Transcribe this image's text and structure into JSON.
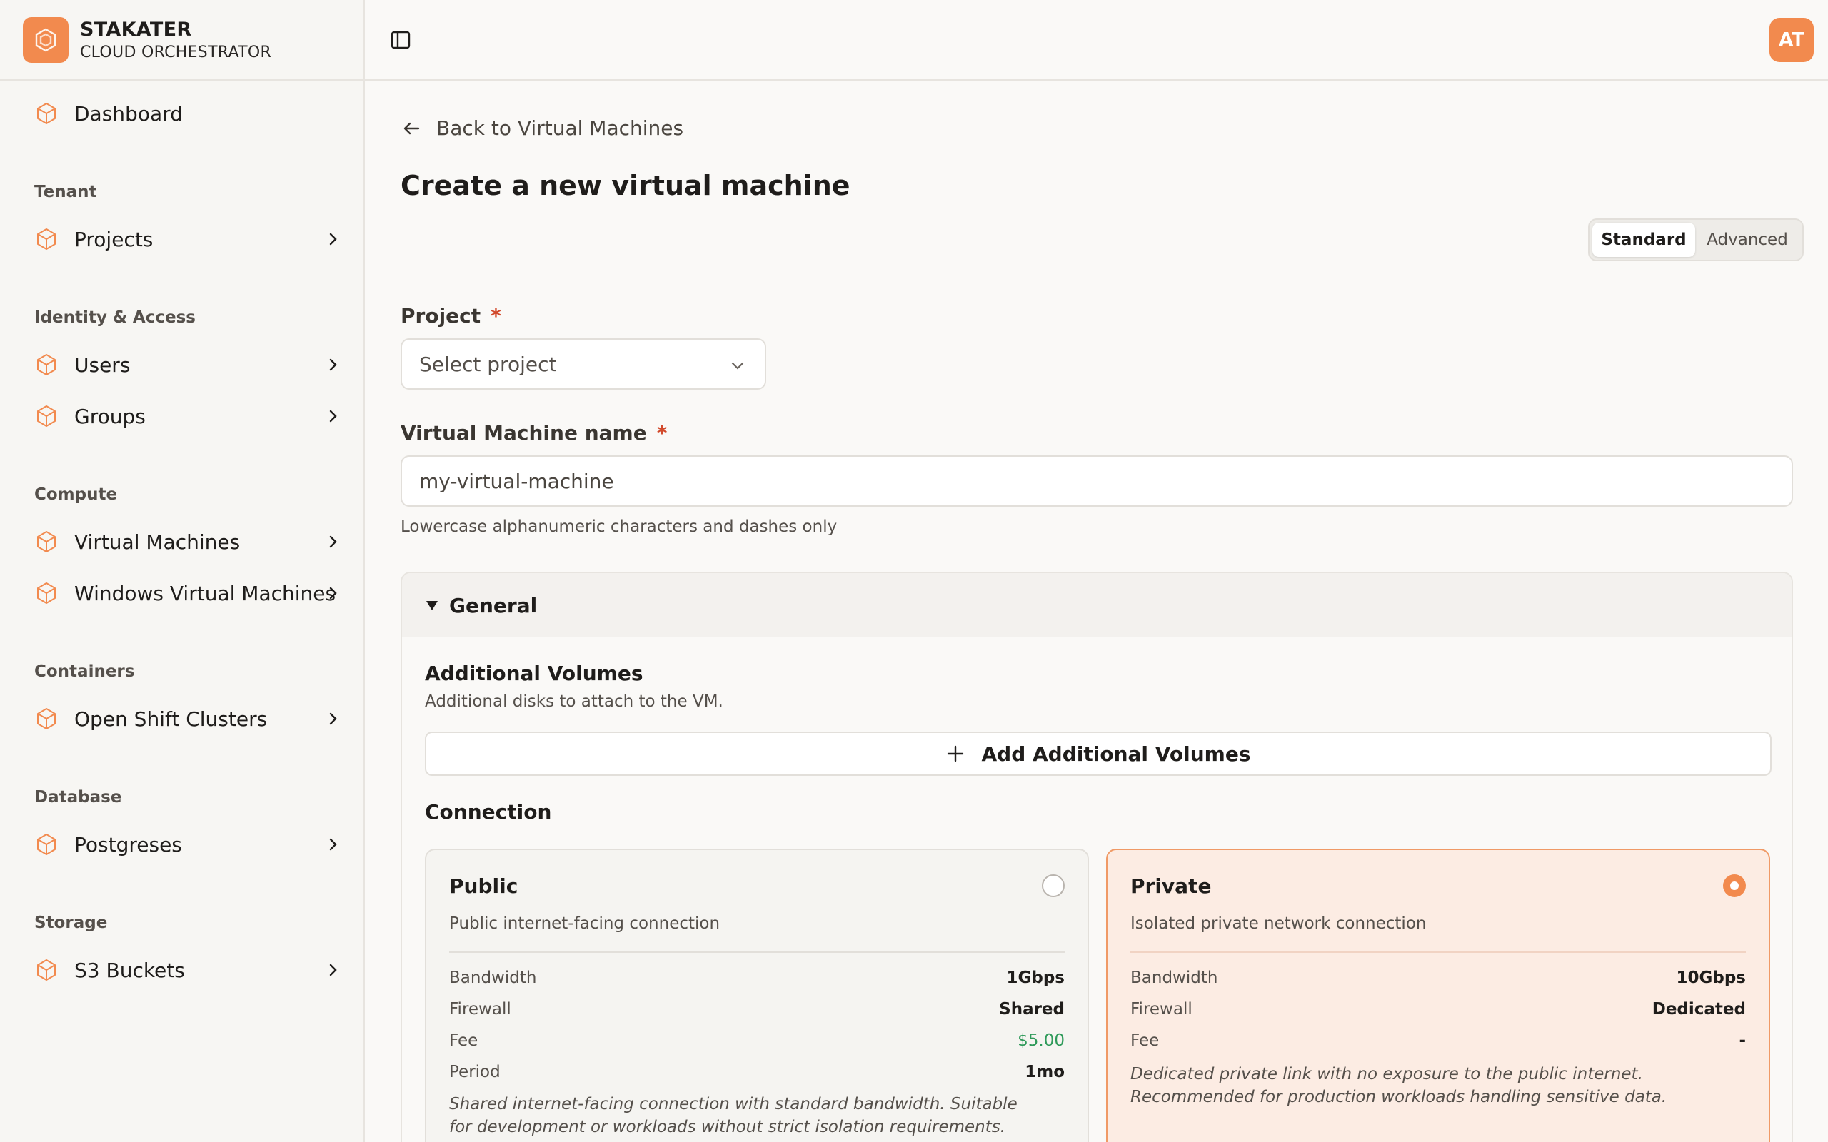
{
  "brand": {
    "title": "STAKATER",
    "subtitle": "CLOUD ORCHESTRATOR",
    "accent": "#f28a4e"
  },
  "topbar": {
    "avatar_initials": "AT"
  },
  "sidebar": {
    "dashboard": "Dashboard",
    "sections": [
      {
        "title": "Tenant",
        "items": [
          "Projects"
        ]
      },
      {
        "title": "Identity & Access",
        "items": [
          "Users",
          "Groups"
        ]
      },
      {
        "title": "Compute",
        "items": [
          "Virtual Machines",
          "Windows Virtual Machines"
        ]
      },
      {
        "title": "Containers",
        "items": [
          "Open Shift Clusters"
        ]
      },
      {
        "title": "Database",
        "items": [
          "Postgreses"
        ]
      },
      {
        "title": "Storage",
        "items": [
          "S3 Buckets"
        ]
      }
    ]
  },
  "main": {
    "back_label": "Back to Virtual Machines",
    "title": "Create a new virtual machine",
    "modes": {
      "standard": "Standard",
      "advanced": "Advanced",
      "selected": "Standard"
    },
    "project": {
      "label": "Project",
      "required_mark": "*",
      "placeholder": "Select project"
    },
    "vm_name": {
      "label": "Virtual Machine name",
      "required_mark": "*",
      "value": "my-virtual-machine",
      "hint": "Lowercase alphanumeric characters and dashes only"
    },
    "general": {
      "title": "General",
      "volumes": {
        "title": "Additional Volumes",
        "description": "Additional disks to attach to the VM.",
        "button": "Add Additional Volumes"
      },
      "connection": {
        "title": "Connection",
        "selected": "Private",
        "public": {
          "title": "Public",
          "description": "Public internet-facing connection",
          "bandwidth_label": "Bandwidth",
          "bandwidth": "1Gbps",
          "firewall_label": "Firewall",
          "firewall": "Shared",
          "fee_label": "Fee",
          "fee": "$5.00",
          "period_label": "Period",
          "period": "1mo",
          "note": "Shared internet-facing connection with standard bandwidth. Suitable for development or workloads without strict isolation requirements."
        },
        "private": {
          "title": "Private",
          "description": "Isolated private network connection",
          "bandwidth_label": "Bandwidth",
          "bandwidth": "10Gbps",
          "firewall_label": "Firewall",
          "firewall": "Dedicated",
          "fee_label": "Fee",
          "fee": "-",
          "note": "Dedicated private link with no exposure to the public internet. Recommended for production workloads handling sensitive data."
        }
      }
    }
  }
}
